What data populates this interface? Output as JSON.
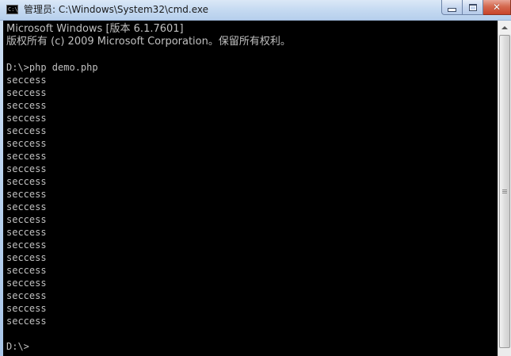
{
  "window": {
    "title": "管理员: C:\\Windows\\System32\\cmd.exe",
    "icon": "cmd-window-icon",
    "icon_label": "C:\\",
    "close_glyph": "✕"
  },
  "console": {
    "lines": [
      "Microsoft Windows [版本 6.1.7601]",
      "版权所有 (c) 2009 Microsoft Corporation。保留所有权利。",
      "",
      "D:\\>php demo.php",
      "seccess",
      "seccess",
      "seccess",
      "seccess",
      "seccess",
      "seccess",
      "seccess",
      "seccess",
      "seccess",
      "seccess",
      "seccess",
      "seccess",
      "seccess",
      "seccess",
      "seccess",
      "seccess",
      "seccess",
      "seccess",
      "seccess",
      "seccess",
      "",
      "D:\\>"
    ]
  },
  "colors": {
    "console_background": "#000000",
    "console_text": "#c0c0c0",
    "close_button": "#c8442a"
  }
}
